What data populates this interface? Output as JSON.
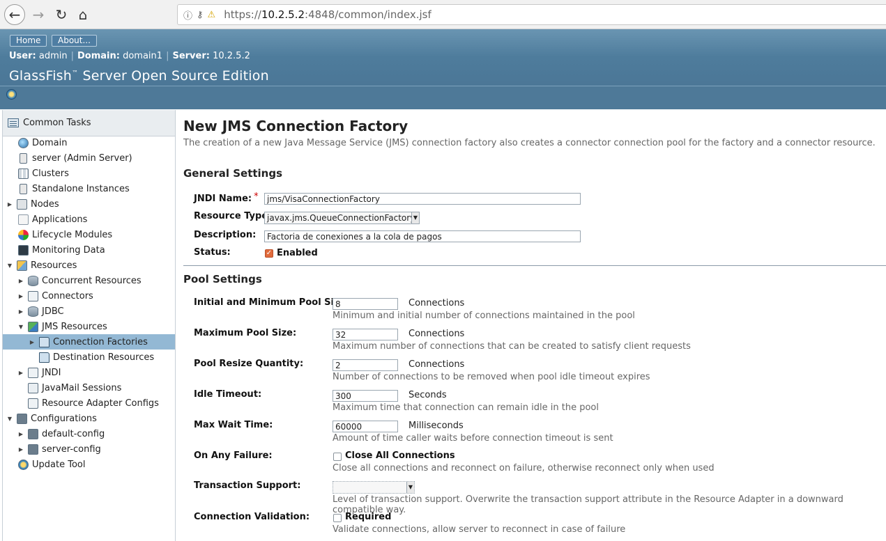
{
  "browser": {
    "back_icon": "arrow-left-icon",
    "forward_icon": "arrow-right-icon",
    "reload_icon": "reload-icon",
    "home_icon": "home-icon",
    "url_prefix": "https://",
    "url_host": "10.2.5.2",
    "url_rest": ":4848/common/index.jsf"
  },
  "header": {
    "home_label": "Home",
    "about_label": "About...",
    "user_label": "User:",
    "user_value": "admin",
    "domain_label": "Domain:",
    "domain_value": "domain1",
    "server_label": "Server:",
    "server_value": "10.2.5.2",
    "product_title": "GlassFish",
    "product_tm": "™",
    "product_rest": " Server Open Source Edition",
    "colors": {
      "header": "#4b7696",
      "selected": "#93b8d4"
    }
  },
  "sidebar": {
    "title": "Common Tasks",
    "items": [
      {
        "label": "Domain"
      },
      {
        "label": "server (Admin Server)"
      },
      {
        "label": "Clusters"
      },
      {
        "label": "Standalone Instances"
      },
      {
        "label": "Nodes",
        "twisty": "▶"
      },
      {
        "label": "Applications"
      },
      {
        "label": "Lifecycle Modules"
      },
      {
        "label": "Monitoring Data"
      },
      {
        "label": "Resources",
        "twisty": "▼"
      },
      {
        "label": "Concurrent Resources",
        "twisty": "▶"
      },
      {
        "label": "Connectors",
        "twisty": "▶"
      },
      {
        "label": "JDBC",
        "twisty": "▶"
      },
      {
        "label": "JMS Resources",
        "twisty": "▼"
      },
      {
        "label": "Connection Factories",
        "twisty": "▶"
      },
      {
        "label": "Destination Resources"
      },
      {
        "label": "JNDI",
        "twisty": "▶"
      },
      {
        "label": "JavaMail Sessions"
      },
      {
        "label": "Resource Adapter Configs"
      },
      {
        "label": "Configurations",
        "twisty": "▼"
      },
      {
        "label": "default-config",
        "twisty": "▶"
      },
      {
        "label": "server-config",
        "twisty": "▶"
      },
      {
        "label": "Update Tool"
      }
    ]
  },
  "main": {
    "title": "New JMS Connection Factory",
    "description": "The creation of a new Java Message Service (JMS) connection factory also creates a connector connection pool for the factory and a connector resource.",
    "general": {
      "heading": "General Settings",
      "jndi_label": "JNDI Name:",
      "jndi_required": "*",
      "jndi_value": "jms/VisaConnectionFactory",
      "type_label": "Resource Type:",
      "type_value": "javax.jms.QueueConnectionFactory",
      "desc_label": "Description:",
      "desc_value": "Factoria de conexiones a la cola de pagos",
      "status_label": "Status:",
      "status_option": "Enabled"
    },
    "pool": {
      "heading": "Pool Settings",
      "initial_label": "Initial and Minimum Pool Size:",
      "initial_value": "8",
      "initial_unit": "Connections",
      "initial_help": "Minimum and initial number of connections maintained in the pool",
      "max_label": "Maximum Pool Size:",
      "max_value": "32",
      "max_unit": "Connections",
      "max_help": "Maximum number of connections that can be created to satisfy client requests",
      "resize_label": "Pool Resize Quantity:",
      "resize_value": "2",
      "resize_unit": "Connections",
      "resize_help": "Number of connections to be removed when pool idle timeout expires",
      "idle_label": "Idle Timeout:",
      "idle_value": "300",
      "idle_unit": "Seconds",
      "idle_help": "Maximum time that connection can remain idle in the pool",
      "wait_label": "Max Wait Time:",
      "wait_value": "60000",
      "wait_unit": "Milliseconds",
      "wait_help": "Amount of time caller waits before connection timeout is sent",
      "failure_label": "On Any Failure:",
      "failure_option": "Close All Connections",
      "failure_help": "Close all connections and reconnect on failure, otherwise reconnect only when used",
      "tx_label": "Transaction Support:",
      "tx_value": "",
      "tx_help": "Level of transaction support. Overwrite the transaction support attribute in the Resource Adapter in a downward compatible way.",
      "validation_label": "Connection Validation:",
      "validation_option": "Required",
      "validation_help": "Validate connections, allow server to reconnect in case of failure"
    }
  }
}
